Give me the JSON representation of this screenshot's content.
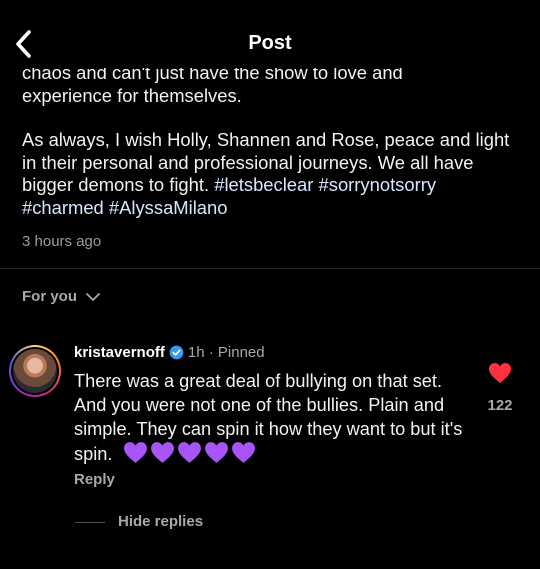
{
  "header": {
    "title": "Post",
    "back_icon": "chevron-left-icon"
  },
  "caption": {
    "cut_line": "chaos and can't just have the show to love and",
    "line2": "experience for themselves.",
    "para2": "As always, I wish Holly, Shannen and Rose, peace and light in their personal and professional journeys. We all have bigger demons to fight.",
    "hashtags": [
      "#letsbeclear",
      "#sorrynotsorry",
      "#charmed",
      "#AlyssaMilano"
    ],
    "time": "3 hours ago"
  },
  "feed": {
    "label": "For you",
    "icon": "chevron-down-icon"
  },
  "comment": {
    "username": "kristavernoff",
    "verified_icon": "verified-badge-icon",
    "meta": "1h · Pinned",
    "text": "There was a great deal of bullying on that set. And you were not one of the bullies. Plain and simple. They can spin it how they want to but it's spin.",
    "emoji_hearts": 5,
    "heart_color": "#a855f7",
    "like_icon": "heart-filled-icon",
    "like_color": "#ff3040",
    "like_count": "122",
    "reply_label": "Reply",
    "hide_replies_label": "Hide replies"
  }
}
